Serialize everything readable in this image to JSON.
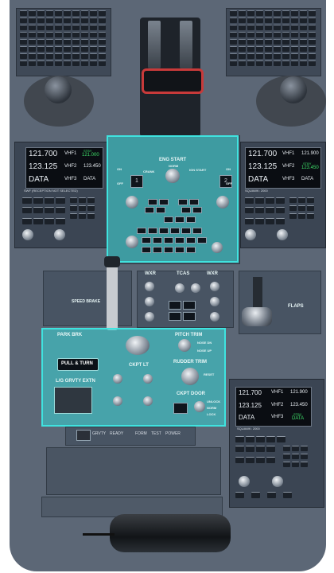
{
  "colors": {
    "console": "#5c6776",
    "highlight": "#3fe3df",
    "screen_text": "#e9eef3",
    "screen_green": "#3ee06a"
  },
  "rmp_left": {
    "row1_freq": "121.700",
    "row1_label": "VHF1",
    "row1_stby_label": "STBY",
    "row1_stby": "121.000",
    "row2_freq": "123.125",
    "row2_label": "VHF2",
    "row2_right": "123.450",
    "row3_freq": "DATA",
    "row3_label": "VHF3",
    "row3_right": "DATA",
    "footer": "SWF (RECEPTION NOT SELECTED)"
  },
  "rmp_right": {
    "row1_freq": "121.700",
    "row1_label": "VHF1",
    "row1_right": "121.900",
    "row2_freq": "123.125",
    "row2_label": "VHF2",
    "row2_stby_label": "STBY",
    "row2_stby": "123.450",
    "row3_freq": "DATA",
    "row3_label": "VHF3",
    "row3_right": "DATA",
    "footer": "SQUAWK: 2000"
  },
  "rmp_third": {
    "row1_freq": "121.700",
    "row1_label": "VHF1",
    "row1_right": "121.900",
    "row2_freq": "123.125",
    "row2_label": "VHF2",
    "row2_right": "123.450",
    "row3_freq": "DATA",
    "row3_label": "VHF3",
    "row3_stby_label": "STBY",
    "row3_stby": "DATA",
    "footer": "SQUAWK: 2000"
  },
  "eng_start": {
    "title": "ENG START",
    "mode_norm": "NORM",
    "mode_crank": "CRANK",
    "mode_ign_start": "IGN START",
    "eng1": "1",
    "eng2": "2",
    "on_label": "ON",
    "off_label": "OFF"
  },
  "labels": {
    "speed_brake": "SPEED BRAKE",
    "flaps": "FLAPS",
    "park_brk": "PARK BRK",
    "pull_turn": "PULL & TURN",
    "lg_gravity": "L/G GRVTY EXTN",
    "ckpt_lt": "CKPT LT",
    "pitch_trim": "PITCH TRIM",
    "rudder_trim": "RUDDER TRIM",
    "ckpt_door": "CKPT DOOR",
    "wxr_left": "WXR",
    "wxr_right": "WXR",
    "tcas": "TCAS",
    "nose_up": "NOSE UP",
    "nose_dn": "NOSE DN",
    "reset": "RESET",
    "unlock": "UNLOCK",
    "norm": "NORM",
    "lock": "LOCK"
  },
  "bottom_buttons": [
    "GRVTY",
    "READY",
    "FORM",
    "TEST",
    "POWER"
  ]
}
